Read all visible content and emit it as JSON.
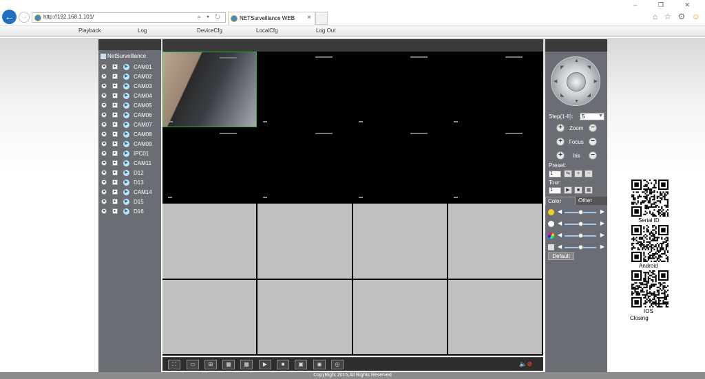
{
  "browser": {
    "url": "http://192.168.1.101/",
    "url_tools": "⌕ ▾ ↻",
    "tab_title": "NETSurveillance WEB",
    "tab_close": "×",
    "window_controls": "– ❐ ✕",
    "back_glyph": "←",
    "forward_glyph": "→",
    "toolbar_icons": [
      "home-icon",
      "star-icon",
      "gear-icon",
      "smiley-icon"
    ]
  },
  "nav": {
    "playback": "Playback",
    "log": "Log",
    "devicecfg": "DeviceCfg",
    "localcfg": "LocalCfg",
    "logout": "Log Out"
  },
  "sidebar": {
    "title": "NetSurveillance",
    "channels": [
      "CAM01",
      "CAM02",
      "CAM03",
      "CAM04",
      "CAM05",
      "CAM06",
      "CAM07",
      "CAM08",
      "CAM09",
      "IPC01",
      "CAM11",
      "D12",
      "D13",
      "CAM14",
      "D15",
      "D16"
    ]
  },
  "ptz": {
    "step_label": "Step(1-8):",
    "step_value": "5",
    "zoom": "Zoom",
    "focus": "Focus",
    "iris": "Iris",
    "preset_label": "Preset:",
    "preset_value": "1",
    "tour_label": "Tour:",
    "tour_value": "1"
  },
  "image_settings": {
    "tab_color": "Color",
    "tab_other": "Other",
    "sliders": [
      {
        "icon": "brightness-icon",
        "level": 0.5
      },
      {
        "icon": "contrast-icon",
        "level": 0.5
      },
      {
        "icon": "saturation-icon",
        "level": 0.5
      },
      {
        "icon": "hue-icon",
        "level": 0.5
      }
    ],
    "default_button": "Default"
  },
  "qr": {
    "serial": "Serial ID",
    "android": "Android",
    "ios": "IOS",
    "closing": "Closing"
  },
  "footer": "CopyRight 2015,All Rights Reserved",
  "colors": {
    "panel": "#6a6e74",
    "header": "#3a3a3a",
    "accent": "#1e6fc4",
    "active_cell_border": "#33aa33"
  }
}
